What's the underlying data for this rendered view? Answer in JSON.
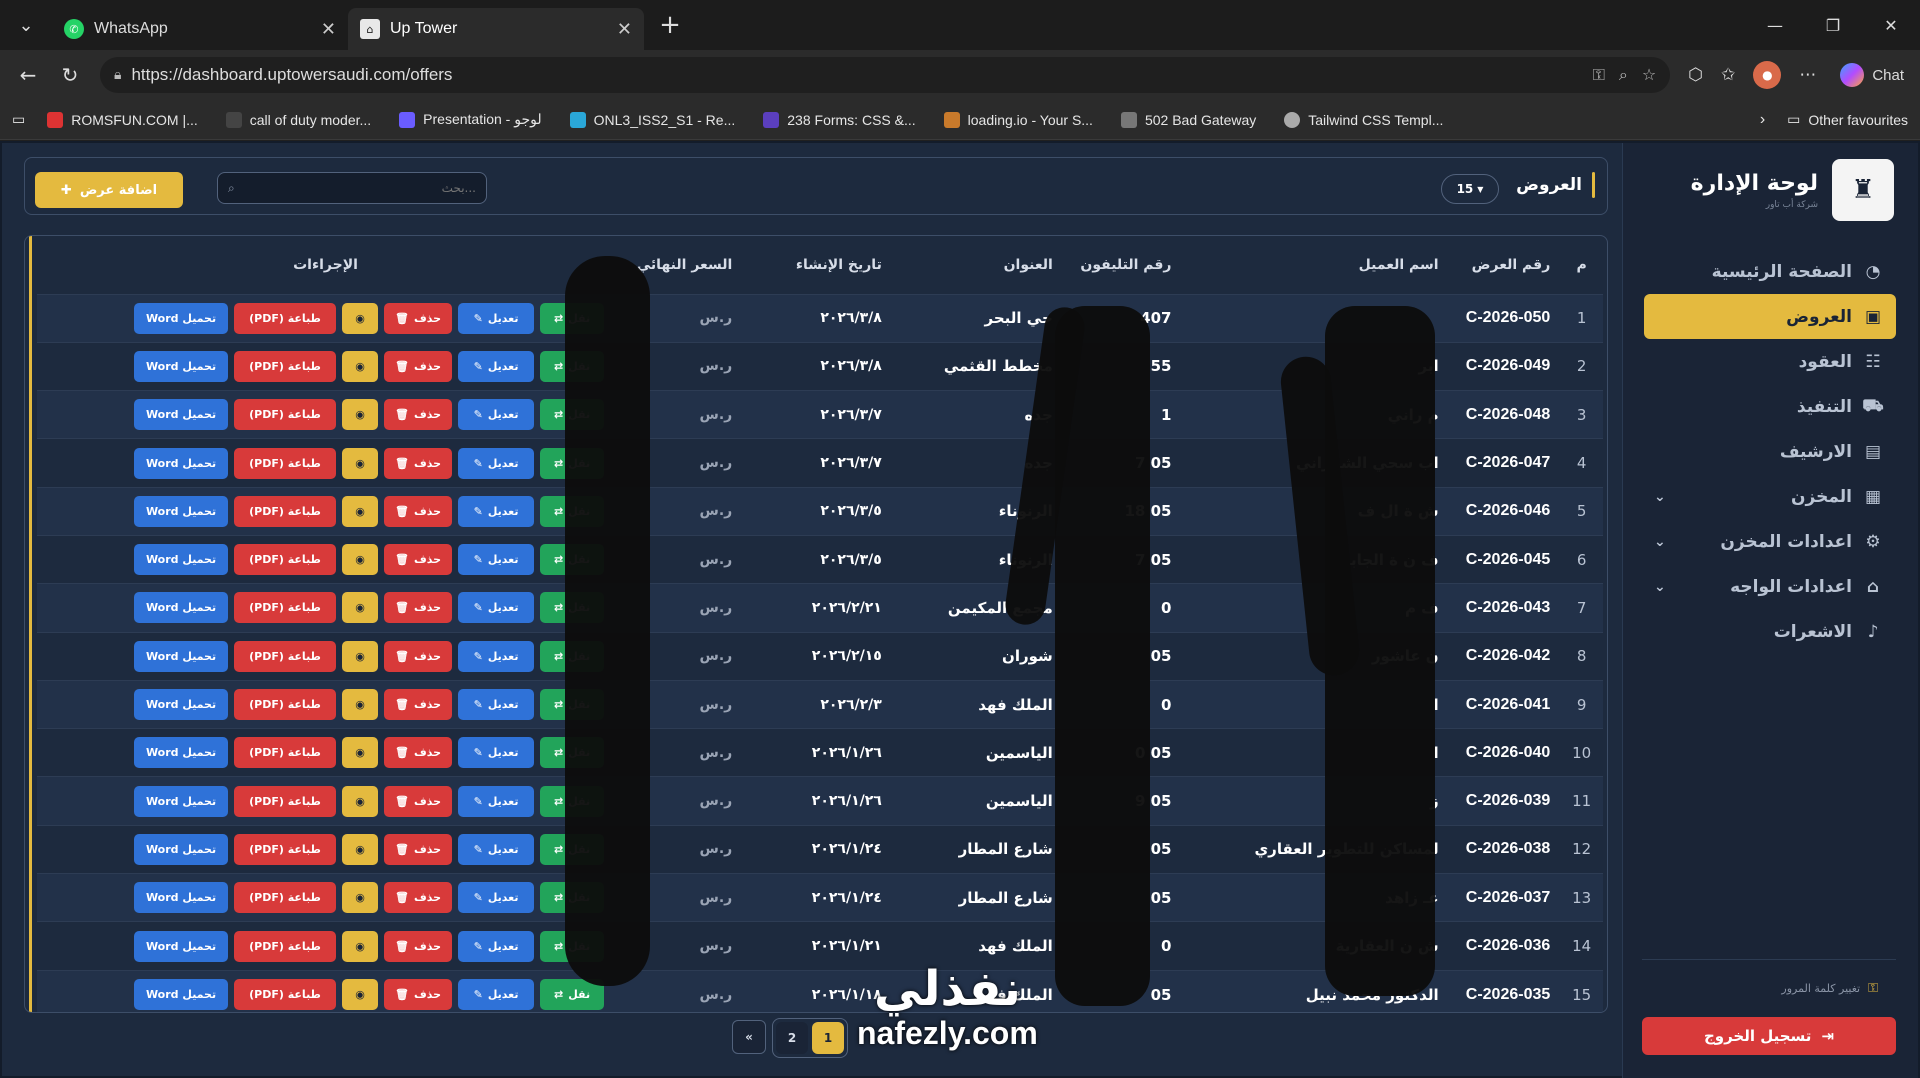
{
  "browser": {
    "tabs": [
      {
        "title": "WhatsApp",
        "icon": "whatsapp-icon"
      },
      {
        "title": "Up Tower",
        "icon": "uptower-icon"
      }
    ],
    "url": "https://dashboard.uptowersaudi.com/offers",
    "chat_label": "Chat",
    "favorites": [
      "ROMSFUN.COM |...",
      "call of duty moder...",
      "Presentation - لوجو",
      "ONL3_ISS2_S1 - Re...",
      "238 Forms: CSS &...",
      "loading.io - Your S...",
      "502 Bad Gateway",
      "Tailwind CSS Templ..."
    ],
    "other_favourites": "Other favourites"
  },
  "sidebar": {
    "title": "لوحة الإدارة",
    "subtitle": "شركة أب تاور",
    "items": [
      {
        "label": "الصفحة الرئيسية",
        "icon": "pie-chart-icon",
        "active": false,
        "has_chevron": false
      },
      {
        "label": "العروض",
        "icon": "offers-icon",
        "active": true,
        "has_chevron": false
      },
      {
        "label": "العقود",
        "icon": "users-icon",
        "active": false,
        "has_chevron": false
      },
      {
        "label": "التنفيذ",
        "icon": "cart-icon",
        "active": false,
        "has_chevron": false
      },
      {
        "label": "الارشيف",
        "icon": "archive-icon",
        "active": false,
        "has_chevron": false
      },
      {
        "label": "المخزن",
        "icon": "warehouse-icon",
        "active": false,
        "has_chevron": true
      },
      {
        "label": "اعدادات المخزن",
        "icon": "gear-icon",
        "active": false,
        "has_chevron": true
      },
      {
        "label": "اعدادات الواجه",
        "icon": "home-icon",
        "active": false,
        "has_chevron": true
      },
      {
        "label": "الاشعرات",
        "icon": "bell-icon",
        "active": false,
        "has_chevron": false
      }
    ],
    "change_password": "تغيير كلمة المرور",
    "logout": "تسجيل الخروج"
  },
  "header": {
    "title": "العروض",
    "page_size": "15",
    "search_placeholder": "بحث...",
    "add_button": "اضافة عرض"
  },
  "table": {
    "columns": [
      "م",
      "رقم العرض",
      "اسم العميل",
      "رقم التليفون",
      "العنوان",
      "تاريخ الإنشاء",
      "السعر النهائي",
      "الإجراءات"
    ],
    "action_labels": {
      "move": "نقل",
      "edit": "تعديل",
      "delete": "حذف",
      "pdf": "طباعة (PDF)",
      "word": "تحميل Word"
    },
    "rows": [
      {
        "n": "1",
        "code": "C-2026-050",
        "client": "",
        "phone": "407",
        "address": "حي البحر",
        "date": "٢٠٢٦/٣/٨",
        "price": "ر.س"
      },
      {
        "n": "2",
        "code": "C-2026-049",
        "client": "ابر",
        "phone": "55",
        "address": "مخطط القثمي",
        "date": "٢٠٢٦/٣/٨",
        "price": "ر.س"
      },
      {
        "n": "3",
        "code": "C-2026-048",
        "client": "م راني",
        "phone": "1",
        "address": "جده",
        "date": "٢٠٢٦/٣/٧",
        "price": "ر.س"
      },
      {
        "n": "4",
        "code": "C-2026-047",
        "client": "اب سحي الشهراني",
        "phone": "05 7",
        "address": "جده",
        "date": "٢٠٢٦/٣/٧",
        "price": "ر.س"
      },
      {
        "n": "5",
        "code": "C-2026-046",
        "client": "ش ة ال ف",
        "phone": "05 18",
        "address": "الرنوناء",
        "date": "٢٠٢٦/٣/٥",
        "price": "ر.س"
      },
      {
        "n": "6",
        "code": "C-2026-045",
        "client": "ف ن ة الجابري",
        "phone": "05 7",
        "address": "الرنوناء",
        "date": "٢٠٢٦/٣/٥",
        "price": "ر.س"
      },
      {
        "n": "7",
        "code": "C-2026-043",
        "client": "ف م",
        "phone": "0",
        "address": "مجمع المكيمن",
        "date": "٢٠٢٦/٢/٢١",
        "price": "ر.س"
      },
      {
        "n": "8",
        "code": "C-2026-042",
        "client": "ن عاشور",
        "phone": "05",
        "address": "شوران",
        "date": "٢٠٢٦/٢/١٥",
        "price": "ر.س"
      },
      {
        "n": "9",
        "code": "C-2026-041",
        "client": "ا",
        "phone": "0",
        "address": "الملك فهد",
        "date": "٢٠٢٦/٢/٣",
        "price": "ر.س"
      },
      {
        "n": "10",
        "code": "C-2026-040",
        "client": "ا",
        "phone": "05 0",
        "address": "الياسمين",
        "date": "٢٠٢٦/١/٢٦",
        "price": "ر.س"
      },
      {
        "n": "11",
        "code": "C-2026-039",
        "client": "ز",
        "phone": "05 9",
        "address": "الياسمين",
        "date": "٢٠٢٦/١/٢٦",
        "price": "ر.س"
      },
      {
        "n": "12",
        "code": "C-2026-038",
        "client": "لمساكن للتطوير العقاري",
        "phone": "05",
        "address": "شارع المطار",
        "date": "٢٠٢٦/١/٢٤",
        "price": "ر.س"
      },
      {
        "n": "13",
        "code": "C-2026-037",
        "client": "عـ زاهد",
        "phone": "05",
        "address": "شارع المطار",
        "date": "٢٠٢٦/١/٢٤",
        "price": "ر.س"
      },
      {
        "n": "14",
        "code": "C-2026-036",
        "client": "ش ن العقارية",
        "phone": "0",
        "address": "الملك فهد",
        "date": "٢٠٢٦/١/٢١",
        "price": "ر.س"
      },
      {
        "n": "15",
        "code": "C-2026-035",
        "client": "الدكتور محمد نبيل",
        "phone": "05",
        "address": "الملك فهد",
        "date": "٢٠٢٦/١/١٨",
        "price": "ر.س"
      }
    ]
  },
  "pagination": {
    "prev": "«",
    "pages": [
      "2",
      "1"
    ],
    "active": "1"
  },
  "watermark": {
    "arabic": "نفذلي",
    "latin": "nafezly.com"
  },
  "colors": {
    "accent": "#e4ba3f",
    "sidebar_bg": "#1a2436",
    "page_bg": "#1d2a3e",
    "danger": "#d83a3a",
    "primary": "#2f72d8",
    "success": "#22a45a"
  }
}
